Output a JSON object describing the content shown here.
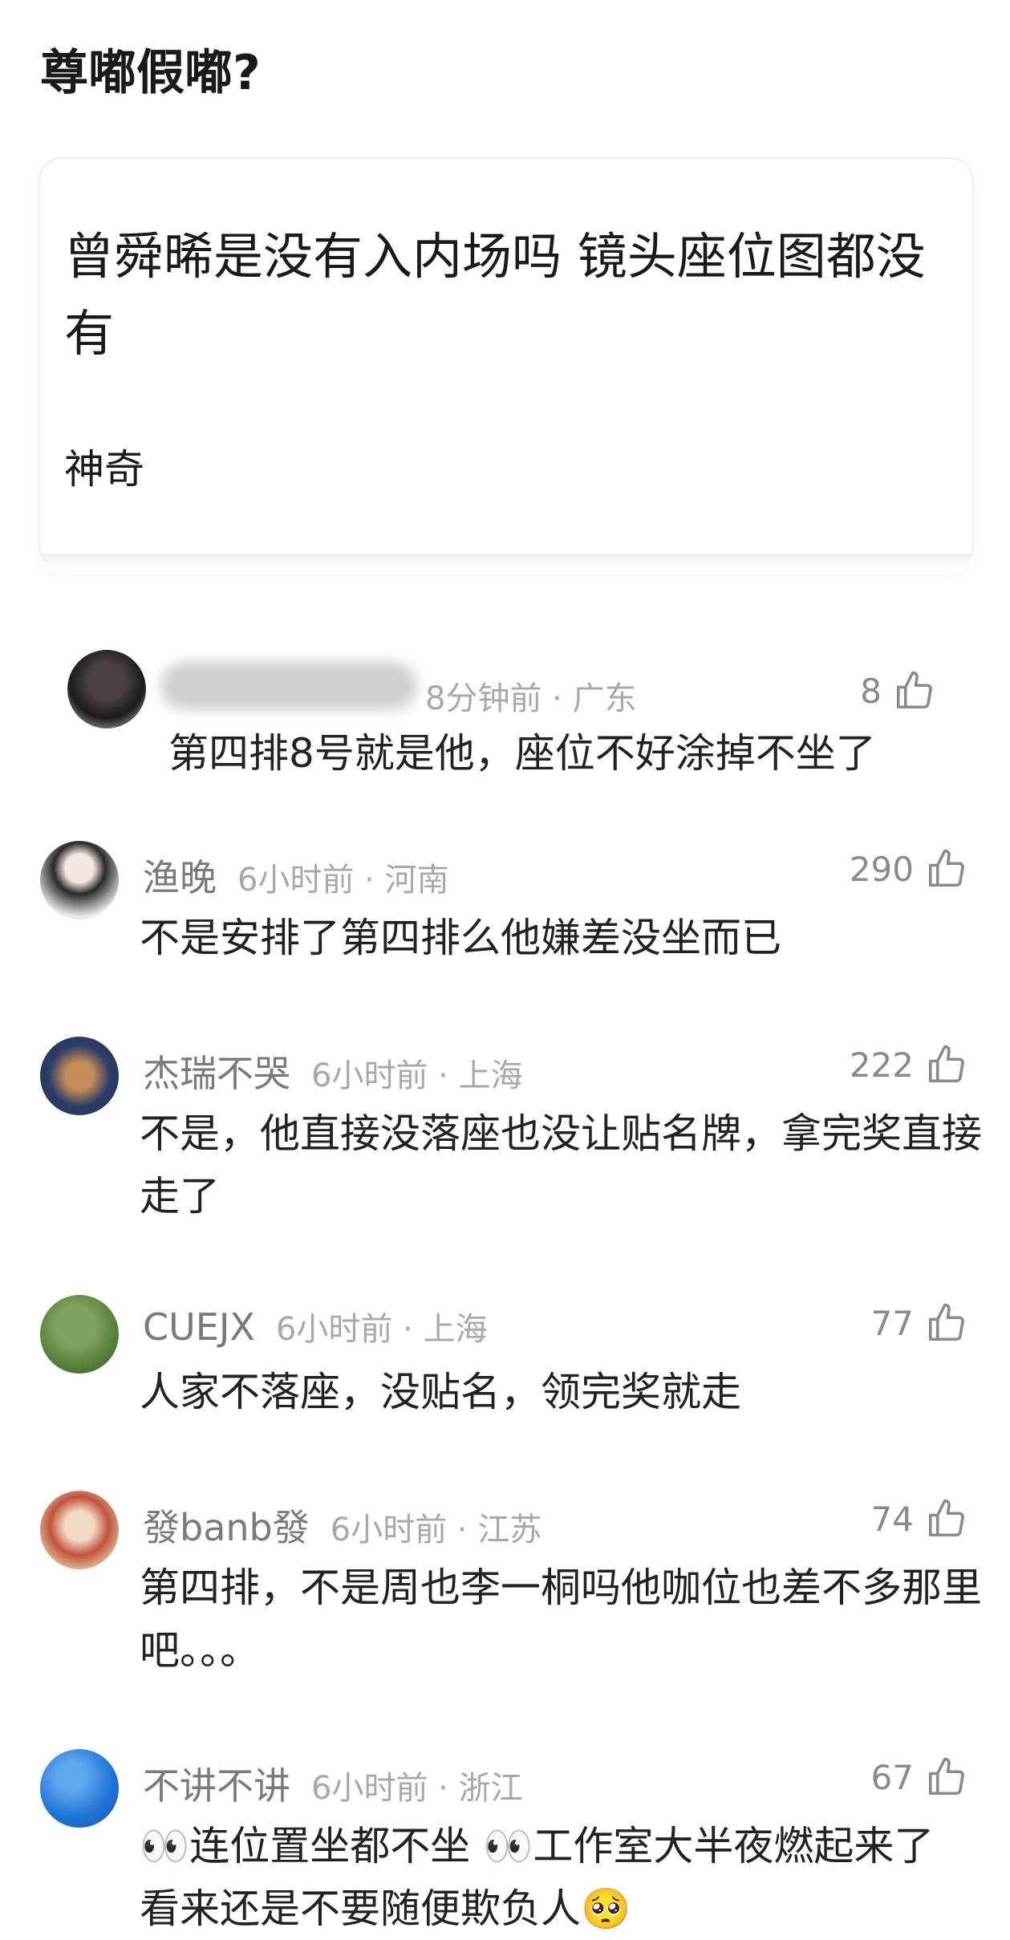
{
  "post": {
    "title": "尊嘟假嘟?",
    "quote_text": "曾舜晞是没有入内场吗 镜头座位图都没有",
    "quote_sub": "神奇"
  },
  "first_reply": {
    "time": "8分钟前 · 广东",
    "likes": "8",
    "text": "第四排8号就是他，座位不好涂掉不坐了"
  },
  "comments": [
    {
      "user": "渔晚",
      "time": "6小时前 · 河南",
      "likes": "290",
      "text": "不是安排了第四排么他嫌差没坐而已"
    },
    {
      "user": "杰瑞不哭",
      "time": "6小时前 · 上海",
      "likes": "222",
      "text": "不是，他直接没落座也没让贴名牌，拿完奖直接走了"
    },
    {
      "user": "CUEJX",
      "time": "6小时前 · 上海",
      "likes": "77",
      "text": "人家不落座，没贴名，领完奖就走"
    },
    {
      "user": "發banb發",
      "time": "6小时前 · 江苏",
      "likes": "74",
      "text": "第四排，不是周也李一桐吗他咖位也差不多那里吧。。。"
    },
    {
      "user": "不讲不讲",
      "time": "6小时前 · 浙江",
      "likes": "67",
      "text": "👀连位置坐都不坐 👀工作室大半夜燃起来了 看来还是不要随便欺负人🥺"
    }
  ],
  "icons": {
    "like": "thumbs-up-icon"
  },
  "colors": {
    "meta_gray": "#a8a8a8",
    "text": "#222222"
  }
}
